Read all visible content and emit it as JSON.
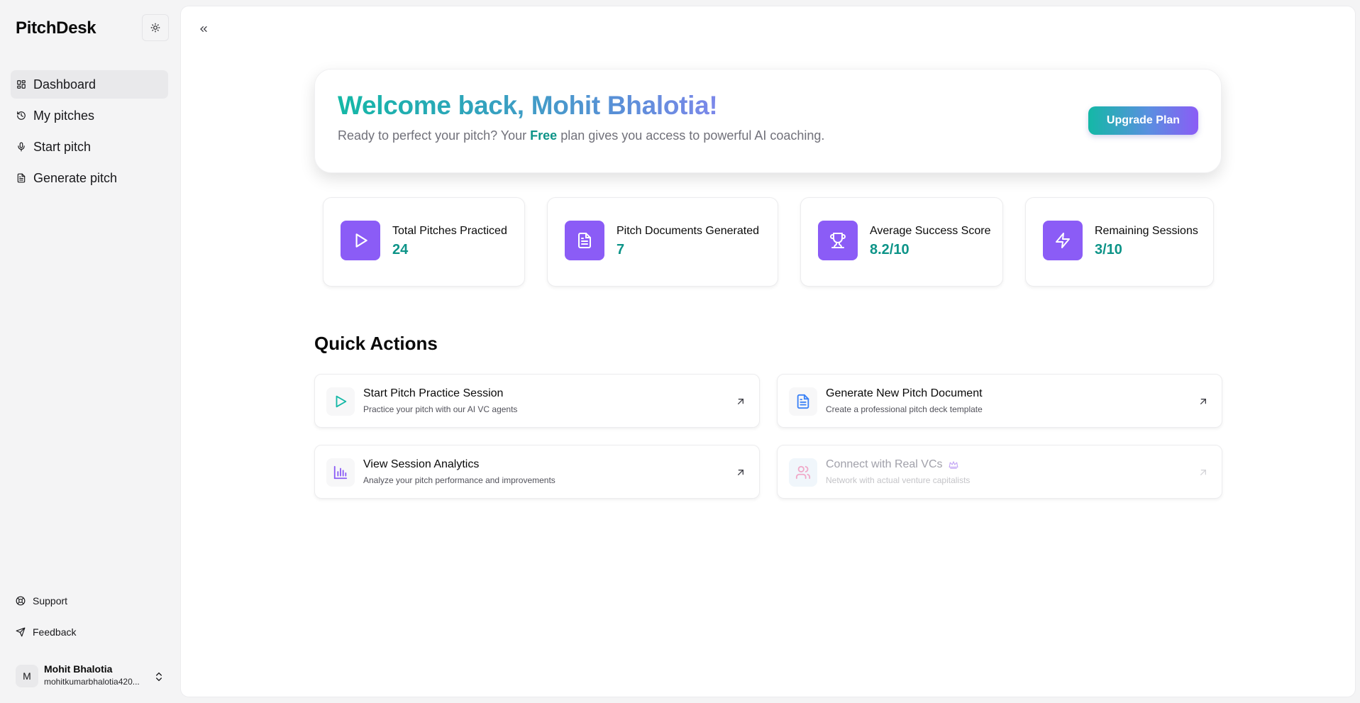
{
  "app": {
    "brand": "PitchDesk"
  },
  "sidebar": {
    "items": [
      {
        "label": "Dashboard",
        "icon": "grid-icon",
        "active": true
      },
      {
        "label": "My pitches",
        "icon": "history-icon"
      },
      {
        "label": "Start pitch",
        "icon": "mic-icon"
      },
      {
        "label": "Generate pitch",
        "icon": "document-icon"
      }
    ],
    "footer": [
      {
        "label": "Support",
        "icon": "lifebuoy-icon"
      },
      {
        "label": "Feedback",
        "icon": "send-icon"
      }
    ],
    "user": {
      "initial": "M",
      "name": "Mohit Bhalotia",
      "email": "mohitkumarbhalotia420..."
    }
  },
  "welcome": {
    "title": "Welcome back, Mohit Bhalotia!",
    "sub_before": "Ready to perfect your pitch? Your ",
    "plan": "Free",
    "sub_after": " plan gives you access to powerful AI coaching.",
    "upgrade_label": "Upgrade Plan"
  },
  "stats": [
    {
      "label": "Total Pitches Practiced",
      "value": "24",
      "icon": "play-icon"
    },
    {
      "label": "Pitch Documents Generated",
      "value": "7",
      "icon": "document-icon"
    },
    {
      "label": "Average Success Score",
      "value": "8.2/10",
      "icon": "trophy-icon"
    },
    {
      "label": "Remaining Sessions",
      "value": "3/10",
      "icon": "zap-icon"
    }
  ],
  "quick_actions": {
    "title": "Quick Actions",
    "items": [
      {
        "name": "Start Pitch Practice Session",
        "desc": "Practice your pitch with our AI VC agents",
        "icon": "play-icon"
      },
      {
        "name": "Generate New Pitch Document",
        "desc": "Create a professional pitch deck template",
        "icon": "document-icon"
      },
      {
        "name": "View Session Analytics",
        "desc": "Analyze your pitch performance and improvements",
        "icon": "bar-chart-icon"
      },
      {
        "name": "Connect with Real VCs",
        "desc": "Network with actual venture capitalists",
        "icon": "users-icon",
        "disabled": true,
        "badge_icon": "crown-icon"
      }
    ]
  },
  "colors": {
    "accent_purple": "#8b5cf6",
    "accent_teal": "#0d9488",
    "sidebar_bg": "#f4f4f5"
  }
}
